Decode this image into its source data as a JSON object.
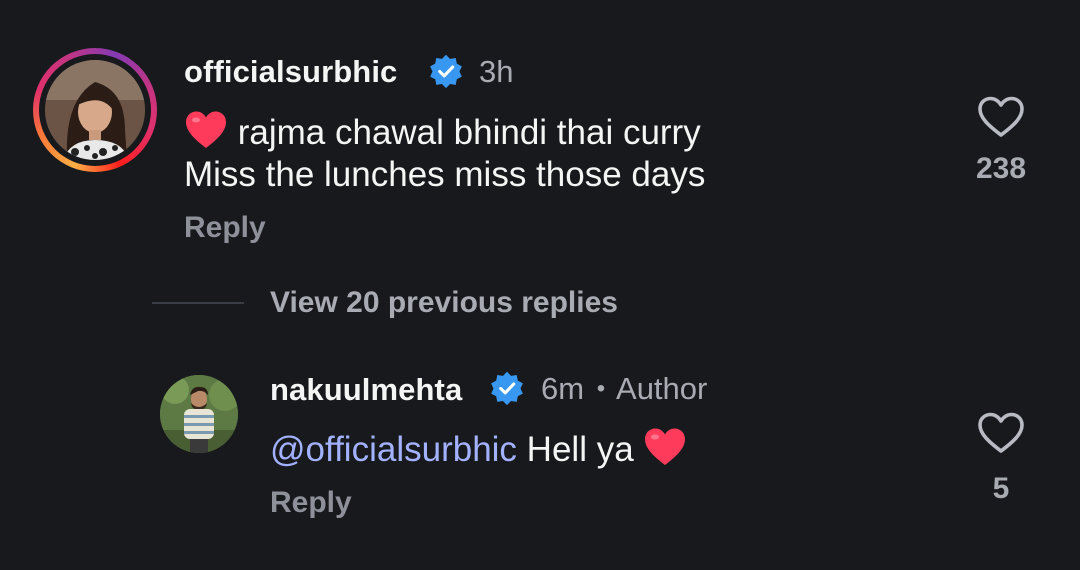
{
  "comment": {
    "username": "officialsurbhic",
    "time": "3h",
    "line1": "rajma chawal bhindi thai curry",
    "line2": "Miss the lunches miss those days",
    "reply_label": "Reply",
    "like_count": "238",
    "avatar_icon": "avatar-photo",
    "verified_icon": "verified-badge-icon",
    "heart_emoji": "red-heart-emoji"
  },
  "thread": {
    "view_replies_label": "View 20 previous replies"
  },
  "reply": {
    "username": "nakuulmehta",
    "time": "6m",
    "separator": "•",
    "author_label": "Author",
    "mention": "@officialsurbhic",
    "text": "Hell ya",
    "reply_label": "Reply",
    "like_count": "5"
  },
  "colors": {
    "background": "#17191d",
    "verified_blue": "#3897f0",
    "mention": "#a3b2ff",
    "heart_red": "#ff3b5c"
  }
}
